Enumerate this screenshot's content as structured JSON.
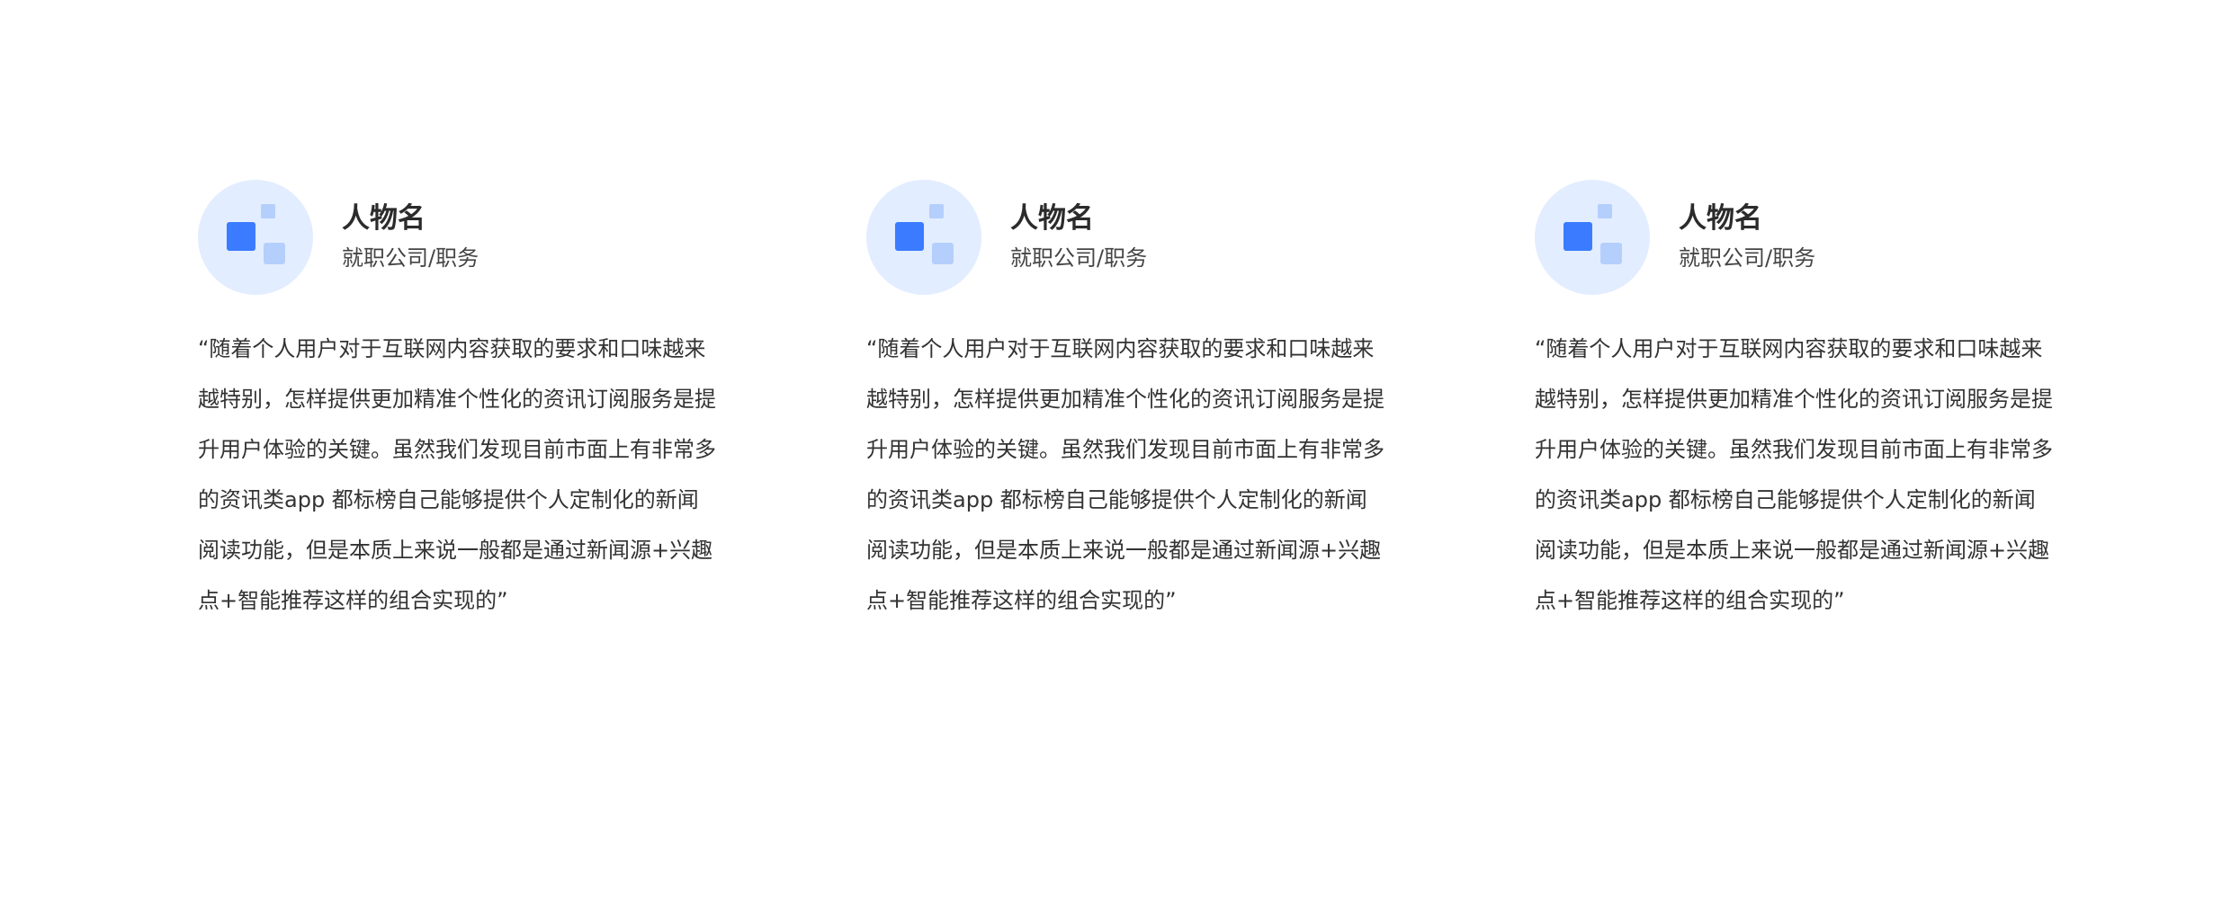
{
  "cards": [
    {
      "name": "人物名",
      "title": "就职公司/职务",
      "quote": "“随着个人用户对于互联网内容获取的要求和口味越来越特别，怎样提供更加精准个性化的资讯订阅服务是提升用户体验的关键。虽然我们发现目前市面上有非常多的资讯类app 都标榜自己能够提供个人定制化的新闻阅读功能，但是本质上来说一般都是通过新闻源+兴趣点+智能推荐这样的组合实现的”"
    },
    {
      "name": "人物名",
      "title": "就职公司/职务",
      "quote": "“随着个人用户对于互联网内容获取的要求和口味越来越特别，怎样提供更加精准个性化的资讯订阅服务是提升用户体验的关键。虽然我们发现目前市面上有非常多的资讯类app 都标榜自己能够提供个人定制化的新闻阅读功能，但是本质上来说一般都是通过新闻源+兴趣点+智能推荐这样的组合实现的”"
    },
    {
      "name": "人物名",
      "title": "就职公司/职务",
      "quote": "“随着个人用户对于互联网内容获取的要求和口味越来越特别，怎样提供更加精准个性化的资讯订阅服务是提升用户体验的关键。虽然我们发现目前市面上有非常多的资讯类app 都标榜自己能够提供个人定制化的新闻阅读功能，但是本质上来说一般都是通过新闻源+兴趣点+智能推荐这样的组合实现的”"
    }
  ],
  "colors": {
    "avatar_bg": "#e2edff",
    "accent": "#3a7bff",
    "accent_light": "#b5cffd",
    "text": "#333333"
  },
  "icons": {
    "avatar": "avatar-placeholder-icon"
  }
}
